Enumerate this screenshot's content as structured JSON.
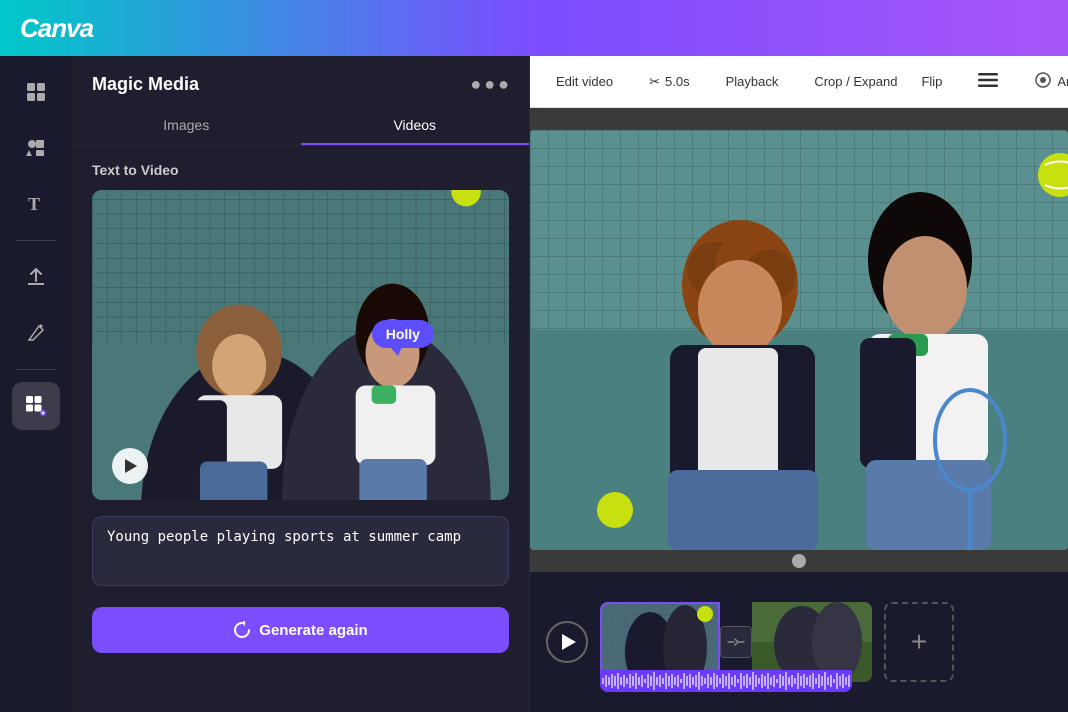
{
  "app": {
    "logo": "Canva"
  },
  "sidebar": {
    "icons": [
      {
        "name": "grid-icon",
        "symbol": "⊞",
        "active": false
      },
      {
        "name": "elements-icon",
        "symbol": "✦✧",
        "active": false
      },
      {
        "name": "text-icon",
        "symbol": "T",
        "active": false
      },
      {
        "name": "upload-icon",
        "symbol": "↑",
        "active": false
      },
      {
        "name": "draw-icon",
        "symbol": "✏",
        "active": false
      },
      {
        "name": "apps-icon",
        "symbol": "⋯",
        "active": true
      }
    ]
  },
  "panel": {
    "title": "Magic Media",
    "menu_label": "•••",
    "tabs": [
      {
        "label": "Images",
        "active": false
      },
      {
        "label": "Videos",
        "active": true
      }
    ],
    "section_label": "Text to Video",
    "holly_tooltip": "Holly",
    "prompt_text": "Young people playing sports at summer camp",
    "generate_btn_label": "Generate again"
  },
  "toolbar": {
    "edit_video_label": "Edit video",
    "scissors_icon": "✂",
    "duration_label": "5.0s",
    "playback_label": "Playback",
    "crop_expand_label": "Crop / Expand",
    "flip_label": "Flip",
    "hamburger_icon": "≡",
    "animate_icon": "◎",
    "animate_label": "Animate"
  },
  "timeline": {
    "plus_label": "+",
    "transition_symbol": "⇔"
  }
}
